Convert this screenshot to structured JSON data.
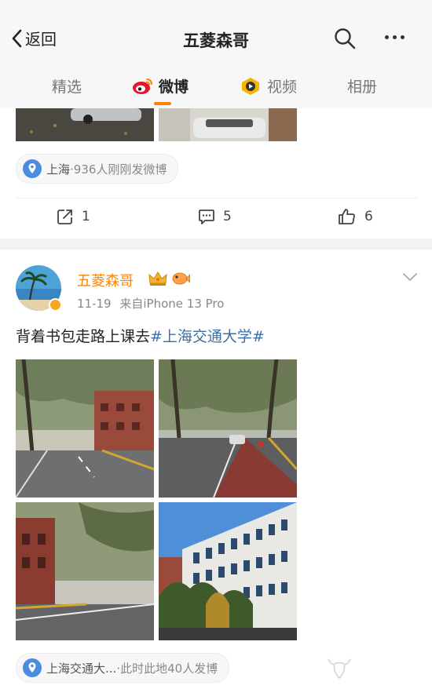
{
  "header": {
    "back_label": "返回",
    "title": "五菱森哥"
  },
  "tabs": [
    {
      "label": "精选"
    },
    {
      "label": "微博"
    },
    {
      "label": "视频"
    },
    {
      "label": "相册"
    }
  ],
  "post1": {
    "location": {
      "place": "上海",
      "text": "·936人刚刚发微博"
    },
    "actions": {
      "repost_count": "1",
      "comment_count": "5",
      "like_count": "6"
    }
  },
  "post2": {
    "author": "五菱森哥",
    "time": "11-19",
    "source": "来自iPhone 13 Pro",
    "text": "背着书包走路上课去",
    "topic": "#上海交通大学#",
    "location": {
      "place": "上海交通大...",
      "text": "·此时此地40人发博"
    }
  },
  "colors": {
    "accent": "#ff8200",
    "topic_link": "#3b6fa8",
    "location_icon": "#4a8ce0"
  },
  "icons": [
    "back-chevron-icon",
    "search-icon",
    "more-icon",
    "weibo-icon",
    "video-icon",
    "location-pin-icon",
    "repost-icon",
    "comment-icon",
    "like-icon",
    "chevron-down-icon",
    "verified-icon",
    "crown-badge-icon",
    "fish-badge-icon"
  ]
}
